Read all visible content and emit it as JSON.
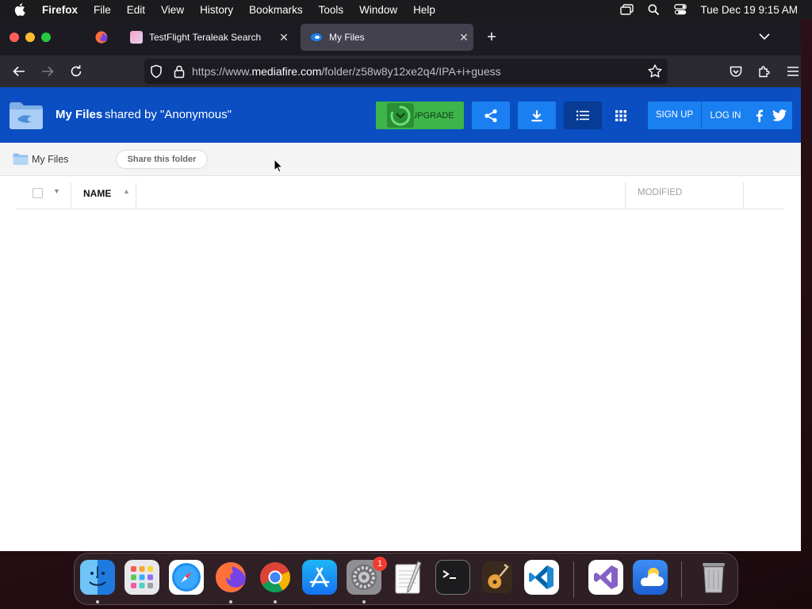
{
  "menubar": {
    "app_name": "Firefox",
    "items": [
      "File",
      "Edit",
      "View",
      "History",
      "Bookmarks",
      "Tools",
      "Window",
      "Help"
    ],
    "clock": "Tue Dec 19  9:15 AM"
  },
  "tabs": [
    {
      "title": "TestFlight Teraleak Search",
      "active": false
    },
    {
      "title": "My Files",
      "active": true
    }
  ],
  "url": {
    "prefix": "https://www.",
    "domain": "mediafire.com",
    "path": "/folder/z58w8y12xe2q4/IPA+i+guess"
  },
  "header": {
    "title": "My Files",
    "shared_by": "shared by \"Anonymous\"",
    "upgrade_label": "UPGRADE",
    "signup_label": "SIGN UP",
    "login_label": "LOG IN"
  },
  "subbar": {
    "breadcrumb": "My Files",
    "share_button": "Share this folder"
  },
  "table": {
    "col_name": "NAME",
    "col_modified": "MODIFIED"
  },
  "dock": {
    "settings_badge": "1"
  },
  "colors": {
    "mediafire_blue": "#0a4ec2",
    "button_blue": "#1a7ff0",
    "upgrade_green": "#3eb44a"
  }
}
